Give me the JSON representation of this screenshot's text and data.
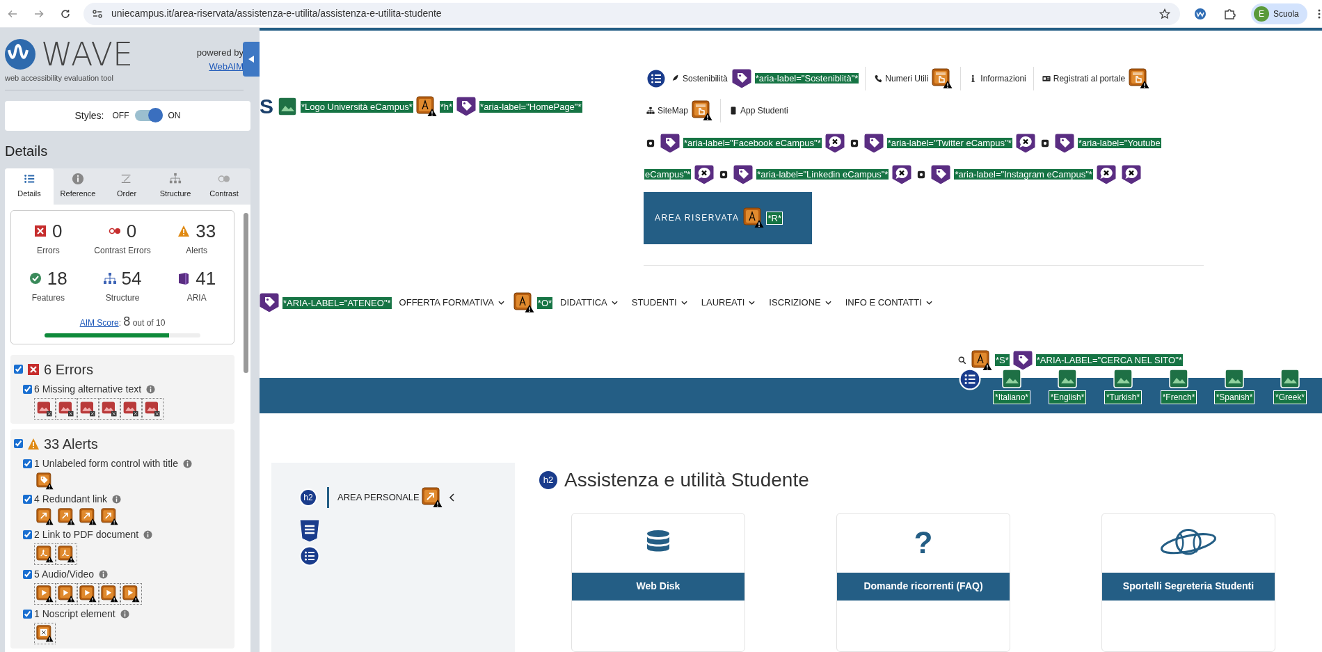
{
  "browser": {
    "url": "uniecampus.it/area-riservata/assistenza-e-utilita/assistenza-e-utilita-studente",
    "avatar": "E",
    "profile": "Scuola"
  },
  "wave": {
    "title": "WAVE",
    "subtitle": "web accessibility evaluation tool",
    "powered_by": "powered by",
    "powered_link": "WebAIM",
    "styles": {
      "label": "Styles:",
      "off": "OFF",
      "on": "ON",
      "enabled": true
    },
    "heading": "Details",
    "tabs": [
      {
        "kind": "details",
        "label": "Details",
        "selected": true
      },
      {
        "kind": "reference",
        "label": "Reference",
        "selected": false
      },
      {
        "kind": "order",
        "label": "Order",
        "selected": false
      },
      {
        "kind": "structure",
        "label": "Structure",
        "selected": false
      },
      {
        "kind": "contrast",
        "label": "Contrast",
        "selected": false
      }
    ],
    "summary": [
      {
        "kind": "errors",
        "count": "0",
        "label": "Errors"
      },
      {
        "kind": "contrast",
        "count": "0",
        "label": "Contrast Errors"
      },
      {
        "kind": "alerts",
        "count": "33",
        "label": "Alerts"
      },
      {
        "kind": "features",
        "count": "18",
        "label": "Features"
      },
      {
        "kind": "structure",
        "count": "54",
        "label": "Structure"
      },
      {
        "kind": "aria",
        "count": "41",
        "label": "ARIA"
      }
    ],
    "aim": {
      "link": "AIM Score",
      "separator": ":",
      "score": "8",
      "suffix": "out of 10",
      "level": 0.8
    },
    "sections": [
      {
        "kind": "errors",
        "title": "6 Errors",
        "checked": true,
        "items": [
          {
            "label": "6 Missing alternative text",
            "checked": true,
            "icons": [
              {
                "kind": "missing-alt"
              },
              {
                "kind": "missing-alt"
              },
              {
                "kind": "missing-alt"
              },
              {
                "kind": "missing-alt"
              },
              {
                "kind": "missing-alt"
              },
              {
                "kind": "missing-alt"
              }
            ]
          }
        ]
      },
      {
        "kind": "alerts",
        "title": "33 Alerts",
        "checked": true,
        "items": [
          {
            "label": "1 Unlabeled form control with title",
            "checked": true,
            "icons": [
              {
                "kind": "form-title"
              }
            ]
          },
          {
            "label": "4 Redundant link",
            "checked": true,
            "icons": [
              {
                "kind": "redundant"
              },
              {
                "kind": "redundant"
              },
              {
                "kind": "redundant"
              },
              {
                "kind": "redundant"
              }
            ]
          },
          {
            "label": "2 Link to PDF document",
            "checked": true,
            "icons": [
              {
                "kind": "pdf"
              },
              {
                "kind": "pdf"
              }
            ]
          },
          {
            "label": "5 Audio/Video",
            "checked": true,
            "icons": [
              {
                "kind": "media"
              },
              {
                "kind": "media"
              },
              {
                "kind": "media"
              },
              {
                "kind": "media"
              },
              {
                "kind": "media"
              }
            ]
          },
          {
            "label": "1 Noscript element",
            "checked": true,
            "icons": [
              {
                "kind": "noscript"
              }
            ]
          }
        ]
      }
    ]
  },
  "page": {
    "logo_fragment": "S",
    "header_left": [
      {
        "kind": "image-ok"
      },
      {
        "kind": "label",
        "text": "*Logo Università eCampus*"
      },
      {
        "kind": "alert-a"
      },
      {
        "kind": "label",
        "text": "*h*"
      },
      {
        "kind": "aria-tag"
      },
      {
        "kind": "label",
        "text": "*aria-label=\"HomePage\"*"
      }
    ],
    "header_right": [
      {
        "tokens": [
          {
            "kind": "menu-list"
          },
          {
            "kind": "leaf"
          },
          {
            "kind": "link",
            "text": "Sostenibilità"
          },
          {
            "kind": "aria-tag"
          },
          {
            "kind": "label",
            "text": "*aria-label=\"Sosteniblità\"*"
          },
          {
            "kind": "divider"
          },
          {
            "kind": "phone"
          },
          {
            "kind": "link",
            "text": "Numeri Utili"
          },
          {
            "kind": "alert-title"
          },
          {
            "kind": "divider"
          },
          {
            "kind": "info"
          },
          {
            "kind": "link",
            "text": "Informazioni"
          },
          {
            "kind": "divider"
          },
          {
            "kind": "id-card"
          },
          {
            "kind": "link",
            "text": "Registrati al portale"
          },
          {
            "kind": "alert-title"
          }
        ]
      },
      {
        "tokens": [
          {
            "kind": "sitemap"
          },
          {
            "kind": "link",
            "text": "SiteMap"
          },
          {
            "kind": "alert-title"
          },
          {
            "kind": "divider"
          },
          {
            "kind": "mobile"
          },
          {
            "kind": "link",
            "text": "App Studenti"
          }
        ]
      },
      {
        "tokens": [
          {
            "kind": "social"
          },
          {
            "kind": "aria-tag"
          },
          {
            "kind": "label",
            "text": "*aria-label=\"Facebook eCampus\"*"
          },
          {
            "kind": "bubble-x"
          },
          {
            "kind": "social"
          },
          {
            "kind": "aria-tag"
          },
          {
            "kind": "label",
            "text": "*aria-label=\"Twitter eCampus\"*"
          },
          {
            "kind": "bubble-x"
          },
          {
            "kind": "social"
          },
          {
            "kind": "aria-tag"
          },
          {
            "kind": "label",
            "text": "*aria-label=\"Youtube eCampus\"*"
          },
          {
            "kind": "bubble-x"
          },
          {
            "kind": "social"
          },
          {
            "kind": "aria-tag"
          },
          {
            "kind": "label",
            "text": "*aria-label=\"Linkedin eCampus\"*"
          },
          {
            "kind": "bubble-x"
          },
          {
            "kind": "social"
          },
          {
            "kind": "aria-tag"
          },
          {
            "kind": "label",
            "text": "*aria-label=\"Instagram eCampus\"*"
          },
          {
            "kind": "bubble-x"
          },
          {
            "kind": "bubble-x"
          }
        ]
      }
    ],
    "reserved": {
      "label": "AREA RISERVATA",
      "tokens": [
        {
          "kind": "alert-a"
        },
        {
          "kind": "label",
          "text": "*R*"
        }
      ]
    },
    "nav": [
      {
        "kind": "aria-tag"
      },
      {
        "kind": "label",
        "text": "*ARIA-LABEL=\"ATENEO\"*"
      },
      {
        "kind": "menu",
        "text": "OFFERTA FORMATIVA"
      },
      {
        "kind": "alert-a"
      },
      {
        "kind": "label",
        "text": "*O*"
      },
      {
        "kind": "menu",
        "text": "DIDATTICA"
      },
      {
        "kind": "menu",
        "text": "STUDENTI"
      },
      {
        "kind": "menu",
        "text": "LAUREATI"
      },
      {
        "kind": "menu",
        "text": "ISCRIZIONE"
      },
      {
        "kind": "menu",
        "text": "INFO E CONTATTI"
      }
    ],
    "search": [
      {
        "kind": "search"
      },
      {
        "kind": "alert-a"
      },
      {
        "kind": "label",
        "text": "*S*"
      },
      {
        "kind": "aria-tag"
      },
      {
        "kind": "label",
        "text": "*ARIA-LABEL=\"CERCA NEL SITO\"*"
      }
    ],
    "languages": [
      {
        "label": "*Italiano*"
      },
      {
        "label": "*English*"
      },
      {
        "label": "*Turkish*"
      },
      {
        "label": "*French*"
      },
      {
        "label": "*Spanish*"
      },
      {
        "label": "*Greek*"
      }
    ],
    "sidebar": {
      "badge": "h2",
      "title": "AREA PERSONALE"
    },
    "heading": {
      "badge": "h2",
      "text": "Assistenza e utilità Studente"
    },
    "cards": [
      {
        "kind": "database",
        "title": "Web Disk"
      },
      {
        "kind": "glyph",
        "glyph": "?",
        "title": "Domande ricorrenti (FAQ)"
      },
      {
        "kind": "planet",
        "title": "Sportelli Segreteria Studenti"
      }
    ]
  }
}
